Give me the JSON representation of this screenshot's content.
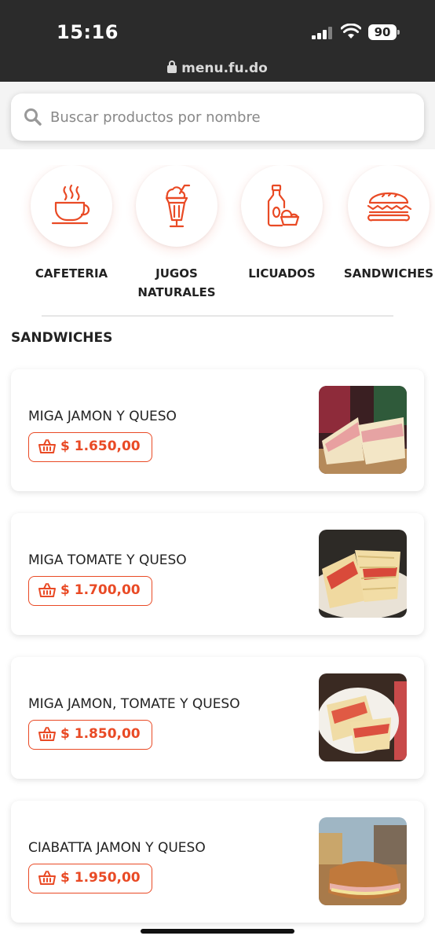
{
  "status": {
    "time": "15:16",
    "battery": "90",
    "url": "menu.fu.do"
  },
  "search": {
    "placeholder": "Buscar productos por nombre"
  },
  "categories": [
    {
      "label": "CAFETERIA",
      "icon": "coffee-cup-icon"
    },
    {
      "label": "JUGOS\nNATURALES",
      "icon": "milkshake-icon"
    },
    {
      "label": "LICUADOS",
      "icon": "smoothie-bottle-icon"
    },
    {
      "label": "SANDWICHES",
      "icon": "sandwich-icon"
    }
  ],
  "section": {
    "title": "SANDWICHES"
  },
  "products": [
    {
      "name": "MIGA JAMON Y QUESO",
      "price": "$ 1.650,00"
    },
    {
      "name": "MIGA TOMATE Y QUESO",
      "price": "$ 1.700,00"
    },
    {
      "name": "MIGA JAMON, TOMATE Y QUESO",
      "price": "$ 1.850,00"
    },
    {
      "name": "CIABATTA JAMON Y QUESO",
      "price": "$ 1.950,00"
    }
  ],
  "colors": {
    "accent": "#e94a25",
    "statusbar": "#2b2b2b"
  }
}
